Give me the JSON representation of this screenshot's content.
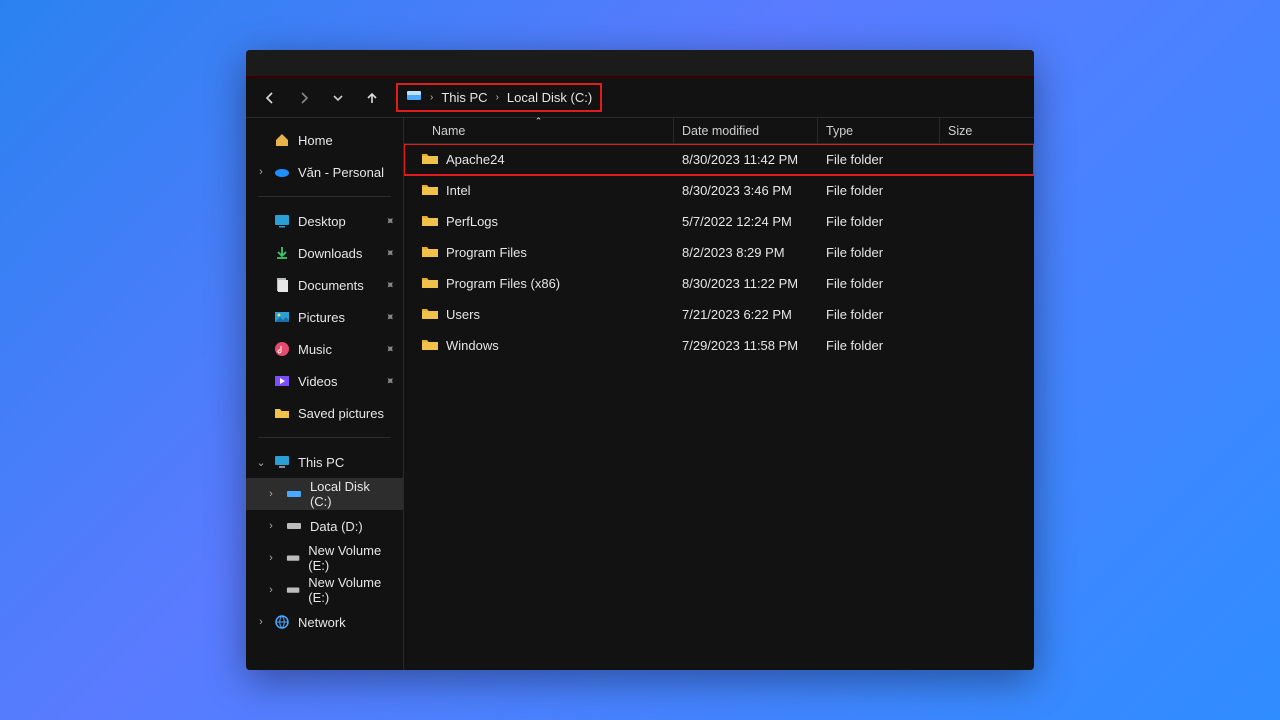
{
  "breadcrumb": {
    "segment1": "This PC",
    "segment2": "Local Disk (C:)"
  },
  "sidebar": {
    "home": "Home",
    "personal": "Văn - Personal",
    "quick": {
      "desktop": "Desktop",
      "downloads": "Downloads",
      "documents": "Documents",
      "pictures": "Pictures",
      "music": "Music",
      "videos": "Videos",
      "saved_pictures": "Saved pictures"
    },
    "this_pc": "This PC",
    "drives": {
      "c": "Local Disk (C:)",
      "d": "Data (D:)",
      "e1": "New Volume (E:)",
      "e2": "New Volume (E:)"
    },
    "network": "Network"
  },
  "columns": {
    "name": "Name",
    "date": "Date modified",
    "type": "Type",
    "size": "Size"
  },
  "rows": [
    {
      "name": "Apache24",
      "date": "8/30/2023 11:42 PM",
      "type": "File folder",
      "highlight": true
    },
    {
      "name": "Intel",
      "date": "8/30/2023 3:46 PM",
      "type": "File folder"
    },
    {
      "name": "PerfLogs",
      "date": "5/7/2022 12:24 PM",
      "type": "File folder"
    },
    {
      "name": "Program Files",
      "date": "8/2/2023 8:29 PM",
      "type": "File folder"
    },
    {
      "name": "Program Files (x86)",
      "date": "8/30/2023 11:22 PM",
      "type": "File folder"
    },
    {
      "name": "Users",
      "date": "7/21/2023 6:22 PM",
      "type": "File folder"
    },
    {
      "name": "Windows",
      "date": "7/29/2023 11:58 PM",
      "type": "File folder"
    }
  ]
}
